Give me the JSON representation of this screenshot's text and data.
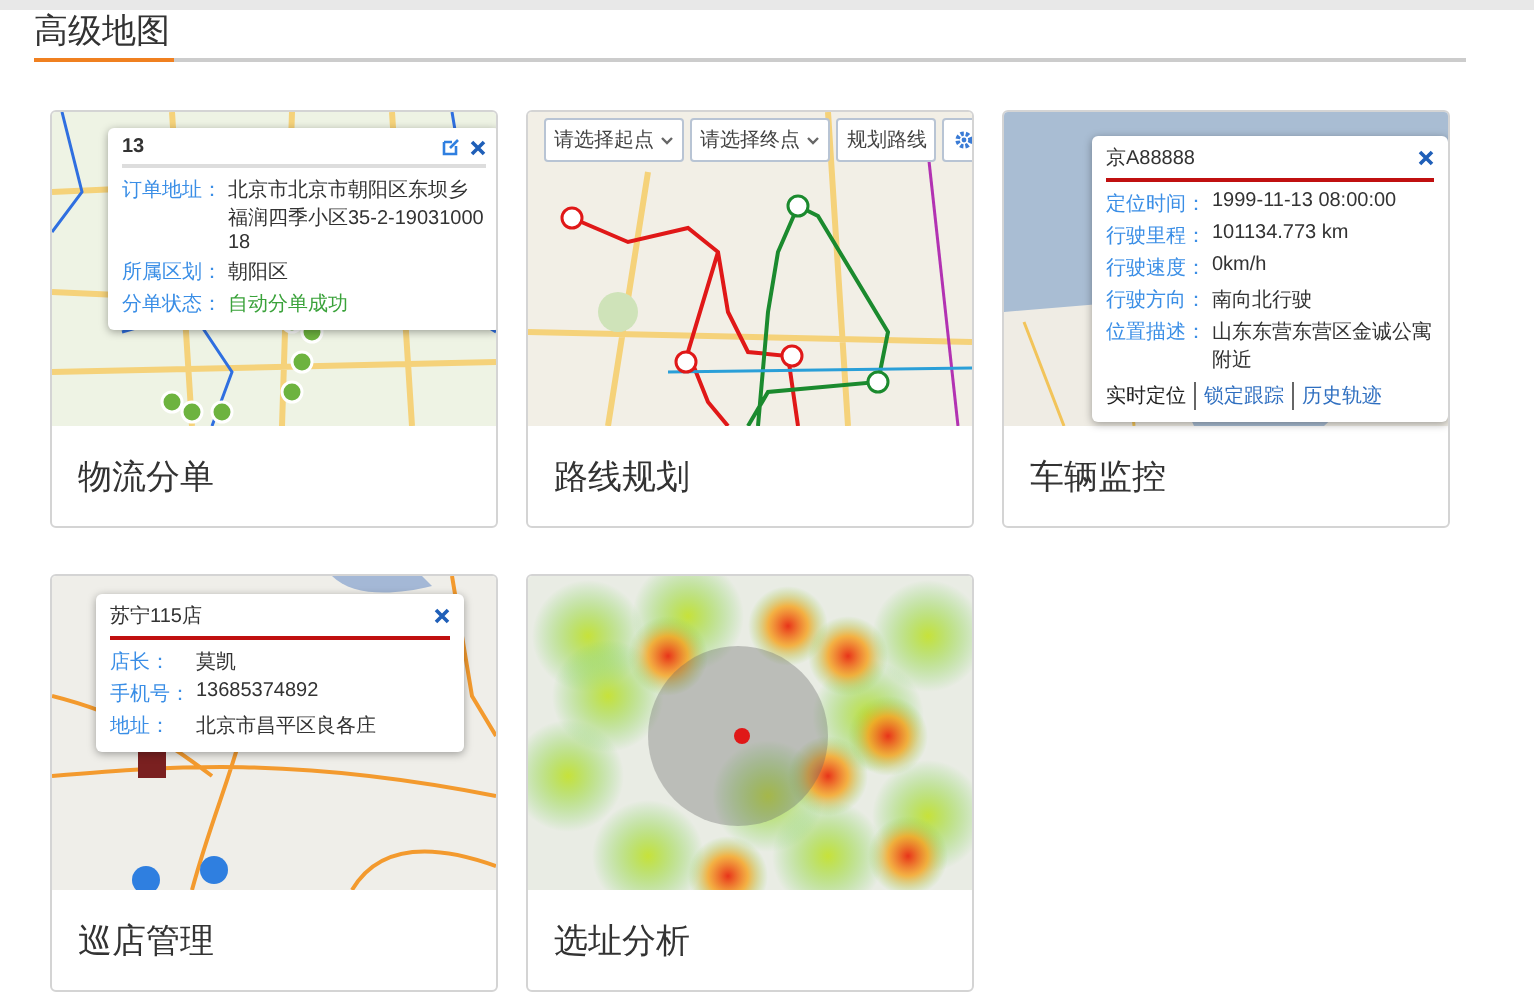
{
  "page": {
    "title": "高级地图"
  },
  "cards": [
    {
      "title": "物流分单",
      "kind": "order",
      "popup": {
        "title": "13",
        "editable": true,
        "rows": [
          {
            "label": "订单地址：",
            "value": "北京市北京市朝阳区东坝乡福润四季小区35-2-1903100018",
            "kind": "text"
          },
          {
            "label": "所属区划：",
            "value": "朝阳区",
            "kind": "text"
          },
          {
            "label": "分单状态：",
            "value": "自动分单成功",
            "kind": "status"
          }
        ]
      }
    },
    {
      "title": "路线规划",
      "kind": "route",
      "toolbar": {
        "selects": [
          "请选择起点",
          "请选择终点"
        ],
        "button": "规划路线"
      }
    },
    {
      "title": "车辆监控",
      "kind": "vehicle",
      "popup": {
        "title": "京A88888",
        "editable": false,
        "rows": [
          {
            "label": "定位时间：",
            "value": "1999-11-13 08:00:00",
            "kind": "text"
          },
          {
            "label": "行驶里程：",
            "value": "101134.773 km",
            "kind": "text"
          },
          {
            "label": "行驶速度：",
            "value": "0km/h",
            "kind": "text"
          },
          {
            "label": "行驶方向：",
            "value": "南向北行驶",
            "kind": "text"
          },
          {
            "label": "位置描述：",
            "value": "山东东营东营区金诚公寓附近",
            "kind": "text"
          }
        ],
        "links": [
          {
            "label": "实时定位",
            "selected": true
          },
          {
            "label": "锁定跟踪",
            "selected": false
          },
          {
            "label": "历史轨迹",
            "selected": false
          }
        ]
      }
    },
    {
      "title": "巡店管理",
      "kind": "store",
      "popup": {
        "title": "苏宁115店",
        "editable": false,
        "rows": [
          {
            "label": "店长：",
            "value": "莫凯",
            "kind": "text"
          },
          {
            "label": "手机号：",
            "value": "13685374892",
            "kind": "text"
          },
          {
            "label": "地址：",
            "value": "北京市昌平区良各庄",
            "kind": "text"
          }
        ]
      }
    },
    {
      "title": "选址分析",
      "kind": "heatmap"
    }
  ]
}
